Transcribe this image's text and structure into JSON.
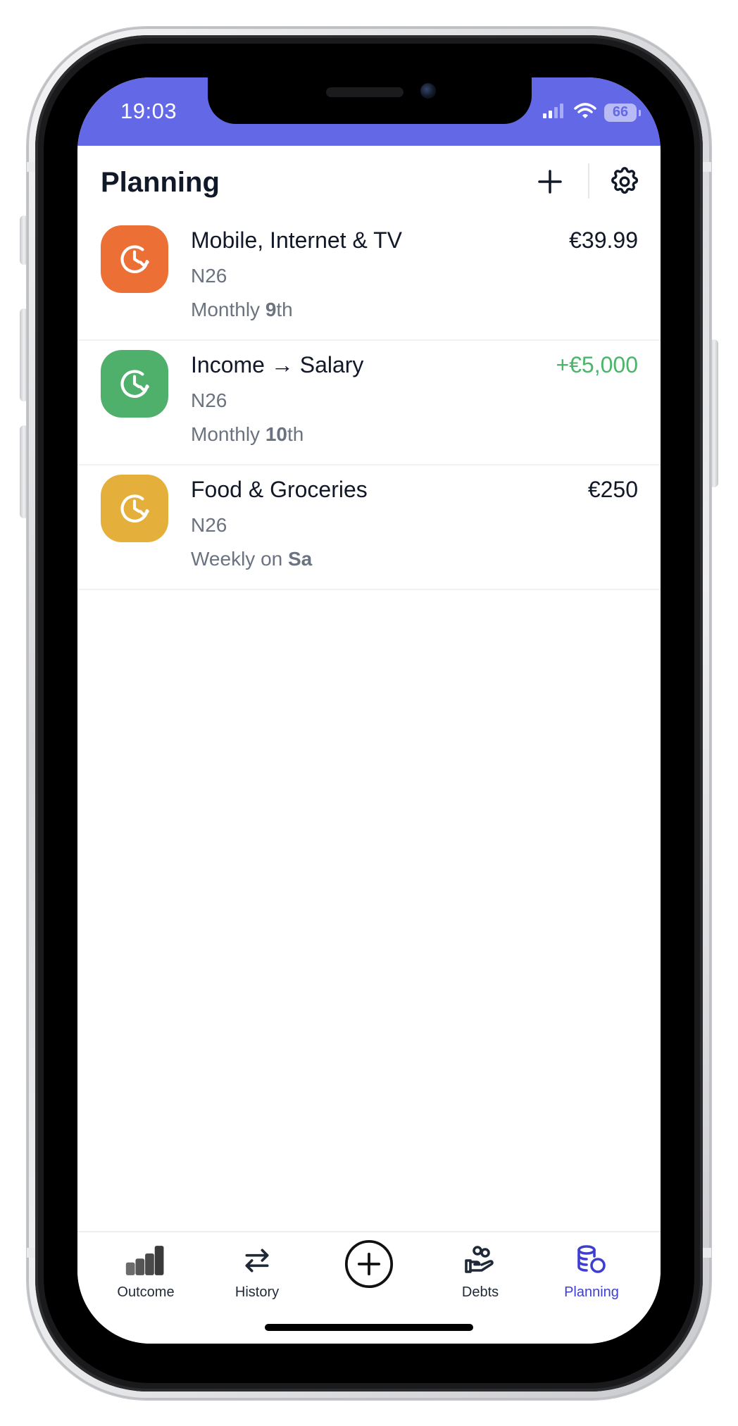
{
  "status_bar": {
    "time": "19:03",
    "battery": "66",
    "background": "#6369e6"
  },
  "header": {
    "title": "Planning",
    "add_icon": "plus-icon",
    "settings_icon": "gear-icon"
  },
  "plans": [
    {
      "name": "Mobile, Internet & TV",
      "account": "N26",
      "schedule_prefix": "Monthly ",
      "schedule_highlight": "9",
      "schedule_suffix": "th",
      "amount": "€39.99",
      "amount_type": "expense",
      "icon": "recurring-clock-icon",
      "color": "#ec6f36"
    },
    {
      "name": "Income → Salary",
      "account": "N26",
      "schedule_prefix": "Monthly ",
      "schedule_highlight": "10",
      "schedule_suffix": "th",
      "amount": "+€5,000",
      "amount_type": "income",
      "icon": "recurring-clock-icon",
      "color": "#4fb06b"
    },
    {
      "name": "Food & Groceries",
      "account": "N26",
      "schedule_prefix": "Weekly on ",
      "schedule_highlight": "Sa",
      "schedule_suffix": "",
      "amount": "€250",
      "amount_type": "expense",
      "icon": "recurring-clock-icon",
      "color": "#e4af3a"
    }
  ],
  "tab_bar": {
    "tabs": [
      {
        "label": "Outcome",
        "icon": "bar-chart-icon",
        "active": false
      },
      {
        "label": "History",
        "icon": "swap-arrows-icon",
        "active": false
      },
      {
        "label": "",
        "icon": "add-circle-icon",
        "active": false
      },
      {
        "label": "Debts",
        "icon": "hand-coins-icon",
        "active": false
      },
      {
        "label": "Planning",
        "icon": "coin-stack-icon",
        "active": true
      }
    ],
    "active_color": "#3f3fcf"
  },
  "colors": {
    "income": "#4cb46b",
    "text_primary": "#111827",
    "text_secondary": "#6b7280"
  }
}
